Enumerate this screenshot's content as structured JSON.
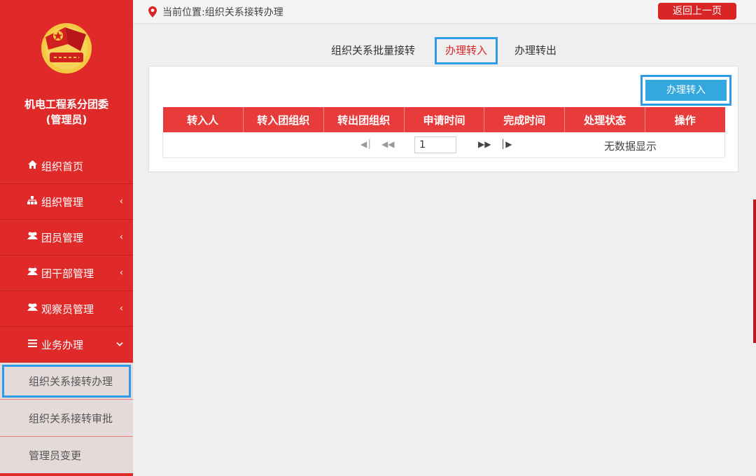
{
  "sidebar": {
    "org_name_line1": "机电工程系分团委",
    "org_name_line2": "(管理员)",
    "items": [
      {
        "label": "组织首页",
        "icon": "home-icon"
      },
      {
        "label": "组织管理",
        "icon": "sitemap-icon"
      },
      {
        "label": "团员管理",
        "icon": "users-icon"
      },
      {
        "label": "团干部管理",
        "icon": "users-icon"
      },
      {
        "label": "观察员管理",
        "icon": "users-icon"
      },
      {
        "label": "业务办理",
        "icon": "menu-icon"
      }
    ],
    "sub_items": [
      {
        "label": "组织关系接转办理"
      },
      {
        "label": "组织关系接转审批"
      },
      {
        "label": "管理员变更"
      }
    ]
  },
  "header": {
    "breadcrumb": "当前位置:组织关系接转办理",
    "back_label": "返回上一页"
  },
  "tabs": [
    {
      "label": "组织关系批量接转"
    },
    {
      "label": "办理转入"
    },
    {
      "label": "办理转出"
    }
  ],
  "panel": {
    "action_label": "办理转入",
    "columns": [
      "转入人",
      "转入团组织",
      "转出团组织",
      "申请时间",
      "完成时间",
      "处理状态",
      "操作"
    ],
    "page_value": "1",
    "empty_text": "无数据显示"
  },
  "colors": {
    "brand_red": "#e02a2a",
    "highlight_blue": "#2e9bea",
    "button_blue": "#33a8df"
  }
}
